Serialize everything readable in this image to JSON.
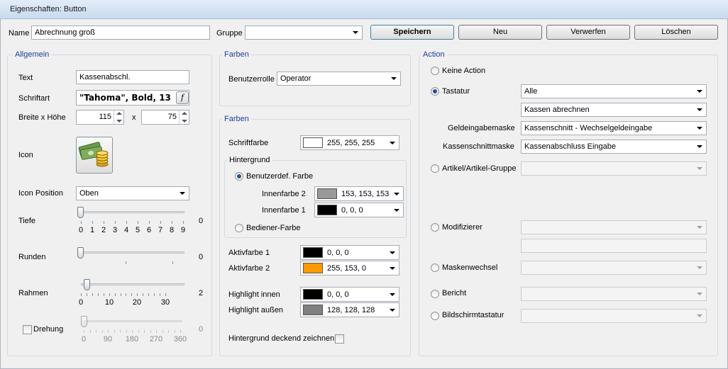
{
  "window": {
    "title": "Eigenschaften: Button"
  },
  "top": {
    "name_label": "Name",
    "name_value": "Abrechnung groß",
    "group_label": "Gruppe",
    "group_value": "",
    "buttons": {
      "save": "Speichern",
      "new": "Neu",
      "discard": "Verwerfen",
      "delete": "Löschen"
    }
  },
  "general": {
    "title": "Allgemein",
    "text_label": "Text",
    "text_value": "Kassenabschl.",
    "font_label": "Schriftart",
    "font_value": "\"Tahoma\", Bold, 13",
    "font_button": "f",
    "size_label": "Breite x Höhe",
    "width": "115",
    "x_sep": "x",
    "height": "75",
    "icon_label": "Icon",
    "icon_name": "money-stack-icon",
    "icon_position_label": "Icon Position",
    "icon_position_value": "Oben",
    "depth_label": "Tiefe",
    "depth_value": "0",
    "depth_level": 0,
    "depth_ticks": [
      "0",
      "1",
      "2",
      "3",
      "4",
      "5",
      "6",
      "7",
      "8",
      "9"
    ],
    "round_label": "Runden",
    "round_value": "0",
    "round_level": 0,
    "frame_label": "Rahmen",
    "frame_value": "2",
    "frame_level": 2,
    "frame_ticks": [
      "0",
      "10",
      "20",
      "30"
    ],
    "rotation_label": "Drehung",
    "rotation_value": "0",
    "rotation_level": 0,
    "rotation_ticks": [
      "0",
      "90",
      "180",
      "270",
      "360"
    ]
  },
  "colors1": {
    "title": "Farben",
    "role_label": "Benutzerrolle",
    "role_value": "Operator"
  },
  "colors2": {
    "title": "Farben",
    "font_color_label": "Schriftfarbe",
    "font_color_value": "255, 255, 255",
    "font_color_hex": "#ffffff",
    "background_title": "Hintergrund",
    "custom_color_label": "Benutzerdef. Farbe",
    "inner2_label": "Innenfarbe 2",
    "inner2_value": "153, 153, 153",
    "inner2_hex": "#999999",
    "inner1_label": "Innenfarbe 1",
    "inner1_value": "0, 0, 0",
    "inner1_hex": "#000000",
    "operator_color_label": "Bediener-Farbe",
    "active1_label": "Aktivfarbe 1",
    "active1_value": "0, 0, 0",
    "active1_hex": "#000000",
    "active2_label": "Aktivfarbe 2",
    "active2_value": "255, 153, 0",
    "active2_hex": "#ff9900",
    "hl_inner_label": "Highlight innen",
    "hl_inner_value": "0, 0, 0",
    "hl_inner_hex": "#000000",
    "hl_outer_label": "Highlight außen",
    "hl_outer_value": "128, 128, 128",
    "hl_outer_hex": "#808080",
    "opaque_label": "Hintergrund deckend zeichnen"
  },
  "action": {
    "title": "Action",
    "none_label": "Keine Action",
    "keyboard_label": "Tastatur",
    "keyboard_value": "Alle",
    "keyboard_value2": "Kassen abrechnen",
    "cash_mask_label": "Geldeingabemaske",
    "cash_mask_value": "Kassenschnitt - Wechselgeldeingabe",
    "cut_mask_label": "Kassenschnittmaske",
    "cut_mask_value": "Kassenabschluss Eingabe",
    "article_label": "Artikel/Artikel-Gruppe",
    "modifier_label": "Modifizierer",
    "mask_change_label": "Maskenwechsel",
    "report_label": "Bericht",
    "screen_kb_label": "Bildschirmtastatur"
  }
}
